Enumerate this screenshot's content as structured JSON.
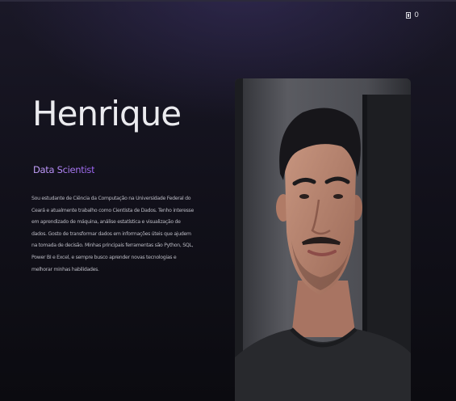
{
  "header": {
    "lang_toggle_icon": "translate-toggle-icon",
    "lang_label": "0"
  },
  "hero": {
    "name": "Henrique",
    "role": "Data Scientist",
    "bio": "Sou estudante de Ciência da Computação na Universidade Federal do Ceará e atualmente trabalho como Cientista de Dados. Tenho interesse em aprendizado de máquina, análise estatística e visualização de dados. Gosto de transformar dados em informações úteis que ajudem na tomada de decisão. Minhas principais ferramentas são Python, SQL, Power BI e Excel, e sempre busco aprender novas tecnologias e melhorar minhas habilidades.",
    "photo_alt": "Portrait photo of Henrique"
  },
  "colors": {
    "background": "#0c0c12",
    "role_gradient_start": "#c8a6ff",
    "role_gradient_end": "#9a62f0",
    "name_text": "#ebebef"
  }
}
